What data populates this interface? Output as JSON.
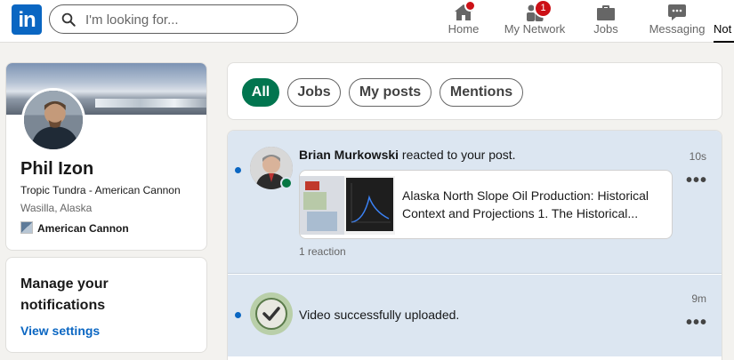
{
  "nav": {
    "logo": "in",
    "search_placeholder": "I'm looking for...",
    "items": [
      {
        "label": "Home",
        "badge": ""
      },
      {
        "label": "My Network",
        "badge": "1"
      },
      {
        "label": "Jobs",
        "badge": ""
      },
      {
        "label": "Messaging",
        "badge": ""
      },
      {
        "label": "Not",
        "badge": ""
      }
    ]
  },
  "profile": {
    "name": "Phil Izon",
    "headline": "Tropic Tundra - American Cannon",
    "location": "Wasilla, Alaska",
    "company": "American Cannon"
  },
  "settings": {
    "title": "Manage your notifications",
    "link": "View settings"
  },
  "filters": [
    "All",
    "Jobs",
    "My posts",
    "Mentions"
  ],
  "notifications": [
    {
      "actor": "Brian Murkowski",
      "action": " reacted to your post.",
      "time": "10s",
      "post_title": "Alaska North Slope Oil Production: Historical Context and Projections 1. The Historical...",
      "reactions": "1 reaction",
      "unread": true
    },
    {
      "text": "Video successfully uploaded.",
      "time": "9m",
      "unread": true
    }
  ],
  "colors": {
    "brand": "#0a66c2",
    "active_filter": "#01754f",
    "unread_bg": "#dce6f1",
    "badge": "#cc1016",
    "online": "#057642"
  }
}
